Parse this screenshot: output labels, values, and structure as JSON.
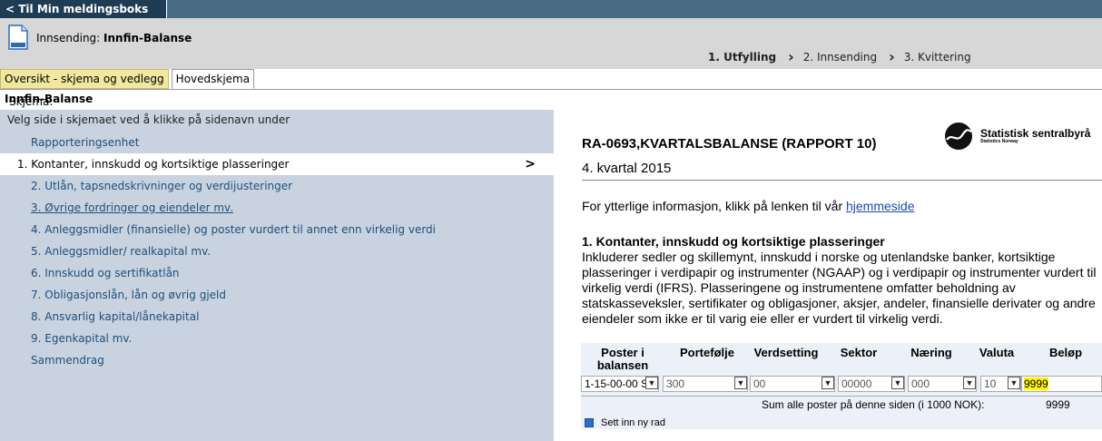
{
  "topbar": {
    "back_label": "< Til Min meldingsboks"
  },
  "header": {
    "innsending_prefix": "Innsending:",
    "innsending_name": "Innfin-Balanse"
  },
  "steps": [
    {
      "label": "1. Utfylling",
      "active": true
    },
    {
      "label": "2. Innsending",
      "active": false
    },
    {
      "label": "3. Kvittering",
      "active": false
    }
  ],
  "tabs": [
    {
      "label": "Oversikt - skjema og vedlegg"
    },
    {
      "label": "Hovedskjema"
    }
  ],
  "skjema": {
    "prefix": "Skjema:",
    "name": "Innfin-Balanse"
  },
  "sidebar": {
    "instruction": "Velg side i skjemaet ved å klikke på sidenavn under",
    "items": [
      {
        "label": "Rapporteringsenhet"
      },
      {
        "label": "1. Kontanter, innskudd og kortsiktige plasseringer",
        "active": true
      },
      {
        "label": "2. Utlån, tapsnedskrivninger og verdijusteringer"
      },
      {
        "label": "3. Øvrige fordringer og eiendeler mv."
      },
      {
        "label": "4. Anleggsmidler (finansielle) og poster vurdert til annet enn virkelig verdi"
      },
      {
        "label": "5. Anleggsmidler/ realkapital mv."
      },
      {
        "label": "6. Innskudd og sertifikatlån"
      },
      {
        "label": "7. Obligasjonslån, lån og øvrig gjeld"
      },
      {
        "label": "8. Ansvarlig kapital/lånekapital"
      },
      {
        "label": "9. Egenkapital mv."
      },
      {
        "label": "Sammendrag"
      }
    ]
  },
  "form": {
    "title": "RA-0693,KVARTALSBALANSE (RAPPORT 10)",
    "quarter": "4. kvartal 2015",
    "info_text": "For ytterlige informasjon, klikk på lenken til vår ",
    "info_link": "hjemmeside",
    "logo_line1": "Statistisk sentralbyrå",
    "logo_line2": "Statistics Norway",
    "section_title": "1. Kontanter, innskudd og kortsiktige plasseringer",
    "section_lines": [
      "Inkluderer sedler og skillemynt, innskudd i norske og utenlandske banker, kortsiktige",
      "plasseringer i verdipapir og instrumenter (NGAAP) og i verdipapir og instrumenter vurdert til",
      "virkelig verdi (IFRS). Plasseringene og instrumentene omfatter beholdning av",
      "statskasseveksler, sertifikater og obligasjoner, aksjer, andeler, finansielle derivater og andre",
      "eiendeler som ikke er til varig eie eller er vurdert til virkelig verdi."
    ]
  },
  "table": {
    "headers": {
      "poster": "Poster i balansen",
      "portefolje": "Portefølje",
      "verdsetting": "Verdsetting",
      "sektor": "Sektor",
      "naering": "Næring",
      "valuta": "Valuta",
      "belop": "Beløp"
    },
    "row": {
      "poster": "1-15-00-00 S",
      "portefolje": "300",
      "verdsetting": "00",
      "sektor": "00000",
      "naering": "000",
      "valuta": "10",
      "belop": "9999"
    },
    "sum_label": "Sum alle poster på denne siden (i 1000 NOK):",
    "sum_value": "9999",
    "add_row_label": "Sett inn ny rad"
  }
}
